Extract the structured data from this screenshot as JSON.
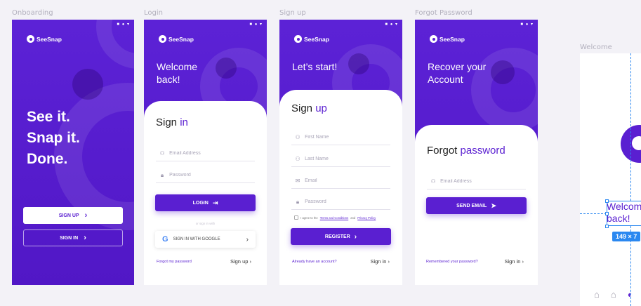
{
  "frames": {
    "onboarding": "Onboarding",
    "login": "Login",
    "signup": "Sign up",
    "forgot": "Forgot Password",
    "welcome": "Welcome"
  },
  "status_icons": "■ ● ▾",
  "brand": "SeeSnap",
  "onboarding": {
    "line1": "See it.",
    "line2": "Snap it.",
    "line3": "Done.",
    "signup_label": "SIGN UP",
    "signin_label": "SIGN IN"
  },
  "login": {
    "hero_line1": "Welcome",
    "hero_line2": "back!",
    "title_plain": "Sign",
    "title_accent": "in",
    "email_placeholder": "Email Address",
    "password_placeholder": "Password",
    "login_label": "LOGIN",
    "or_text": "or sign in with",
    "google_label": "SIGN IN WITH GOOGLE",
    "forgot_link": "Forgot my password",
    "signup_link": "Sign up"
  },
  "signup": {
    "hero_title": "Let’s start!",
    "title_plain": "Sign",
    "title_accent": "up",
    "first_name_placeholder": "First Name",
    "last_name_placeholder": "Last Name",
    "email_placeholder": "Email",
    "password_placeholder": "Password",
    "terms_prefix": "I agree to the",
    "terms_link": "Terms and Conditions",
    "terms_and": "and",
    "privacy_link": "Privacy Policy",
    "register_label": "REGISTER",
    "have_account": "Already have an account?",
    "signin_link": "Sign in"
  },
  "forgot": {
    "hero_line1": "Recover your",
    "hero_line2": "Account",
    "title_plain": "Forgot",
    "title_accent": "password",
    "email_placeholder": "Email Address",
    "send_label": "SEND EMAIL",
    "remembered": "Remembered your password?",
    "signin_link": "Sign in"
  },
  "welcome_selection": {
    "text_line1": "Welcome",
    "text_line2": "back!",
    "size_label": "149 × 7"
  },
  "colors": {
    "brand_purple": "#5a1fd1",
    "guide_blue": "#2b88f0"
  },
  "icons": {
    "user": "user-icon",
    "lock": "lock-icon",
    "mail": "mail-icon",
    "chevron": "chevron-right-icon",
    "send": "send-icon",
    "login": "login-arrow-icon",
    "google": "google-icon",
    "home": "home-icon"
  }
}
